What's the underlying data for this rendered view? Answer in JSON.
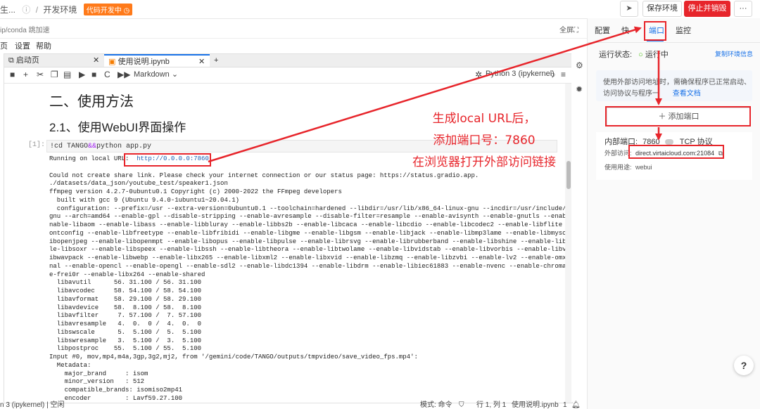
{
  "header": {
    "crumb_prefix": "生...",
    "crumb_title": "开发环境",
    "status_badge": "代码开发中",
    "save_label": "保存环境",
    "stop_label": "停止并销毁",
    "more_label": "···"
  },
  "subbar": {
    "path": "ip/conda 跳加速",
    "fullscreen": "全屏⛶"
  },
  "menu": [
    "页",
    "设置",
    "帮助"
  ],
  "notebook": {
    "tabs": [
      {
        "label": "启动页"
      },
      {
        "label": "使用说明.ipynb"
      }
    ],
    "toolbar": {
      "cell_type": "Markdown",
      "kernel": "Python 3 (ipykernel)"
    },
    "heading2": "二、使用方法",
    "heading3": "2.1、使用WebUI界面操作",
    "cell_prompt": "[1]:",
    "cell_code_1": "!cd TANGO",
    "cell_code_op": "&&",
    "cell_code_2": "python app.py",
    "output_prefix": "Running on local URL:  ",
    "output_url": "http://0.0.0.0:7860",
    "output_body": "Could not create share link. Please check your internet connection or our status page: https://status.gradio.app.\n./datasets/data_json/youtube_test/speaker1.json\nffmpeg version 4.2.7-0ubuntu0.1 Copyright (c) 2000-2022 the FFmpeg developers\n  built with gcc 9 (Ubuntu 9.4.0-1ubuntu1~20.04.1)\n  configuration: --prefix=/usr --extra-version=0ubuntu0.1 --toolchain=hardened --libdir=/usr/lib/x86_64-linux-gnu --incdir=/usr/include/x86_64-linux-\ngnu --arch=amd64 --enable-gpl --disable-stripping --enable-avresample --disable-filter=resample --enable-avisynth --enable-gnutls --enable-ladspa --e\nnable-libaom --enable-libass --enable-libbluray --enable-libbs2b --enable-libcaca --enable-libcdio --enable-libcodec2 --enable-libflite --enable-libf\nontconfig --enable-libfreetype --enable-libfribidi --enable-libgme --enable-libgsm --enable-libjack --enable-libmp3lame --enable-libmysofa --enable-l\nibopenjpeg --enable-libopenmpt --enable-libopus --enable-libpulse --enable-librsvg --enable-librubberband --enable-libshine --enable-libsnappy --enab\nle-libsoxr --enable-libspeex --enable-libssh --enable-libtheora --enable-libtwolame --enable-libvidstab --enable-libvorbis --enable-libvpx --enable-l\nibwavpack --enable-libwebp --enable-libx265 --enable-libxml2 --enable-libxvid --enable-libzmq --enable-libzvbi --enable-lv2 --enable-omx --enable-ope\nnal --enable-opencl --enable-opengl --enable-sdl2 --enable-libdc1394 --enable-libdrm --enable-libiec61883 --enable-nvenc --enable-chromaprint --enabl\ne-frei0r --enable-libx264 --enable-shared\n  libavutil      56. 31.100 / 56. 31.100\n  libavcodec     58. 54.100 / 58. 54.100\n  libavformat    58. 29.100 / 58. 29.100\n  libavdevice    58.  8.100 / 58.  8.100\n  libavfilter     7. 57.100 /  7. 57.100\n  libavresample   4.  0.  0 /  4.  0.  0\n  libswscale      5.  5.100 /  5.  5.100\n  libswresample   3.  5.100 /  3.  5.100\n  libpostproc    55.  5.100 / 55.  5.100\nInput #0, mov,mp4,m4a,3gp,3g2,mj2, from '/gemini/code/TANGO/outputs/tmpvideo/save_video_fps.mp4':\n  Metadata:\n    major_brand     : isom\n    minor_version   : 512\n    compatible_brands: isomiso2mp41\n    encoder         : Lavf59.27.100"
  },
  "statusbar": {
    "left": "n 3 (ipykernel) | 空闲",
    "mode": "模式: 命令",
    "position": "行 1, 列 1",
    "file": "使用说明.ipynb",
    "num": "1"
  },
  "right_panel": {
    "tabs": [
      {
        "label": "配置"
      },
      {
        "label": "快"
      },
      {
        "label": "端口"
      },
      {
        "label": "监控"
      }
    ],
    "run_label": "运行状态:",
    "run_value": "运行中",
    "copy_link": "复制环境信息",
    "notice_line1": "使用外部访问地址时，需确保程序已正常启动、",
    "notice_line2": "访问协议与程序一",
    "notice_link": "查看文档",
    "add_port": "添加端口",
    "internal_port_label": "内部端口:",
    "internal_port_value": "7860",
    "protocol": "TCP 协议",
    "external_label": "外部访问:",
    "external_value": "direct.virtaicloud.com:21084",
    "usage_label": "使用用途:",
    "usage_value": "webui"
  },
  "annotation": {
    "line1": "生成local URL后，",
    "line2": "添加端口号：7860",
    "line3": "在浏览器打开外部访问链接"
  },
  "help_label": "?",
  "colors": {
    "accent_red": "#e7252b",
    "brand_blue": "#1a73e8",
    "badge_orange": "#ff7a1a",
    "running_green": "#52c41a"
  }
}
